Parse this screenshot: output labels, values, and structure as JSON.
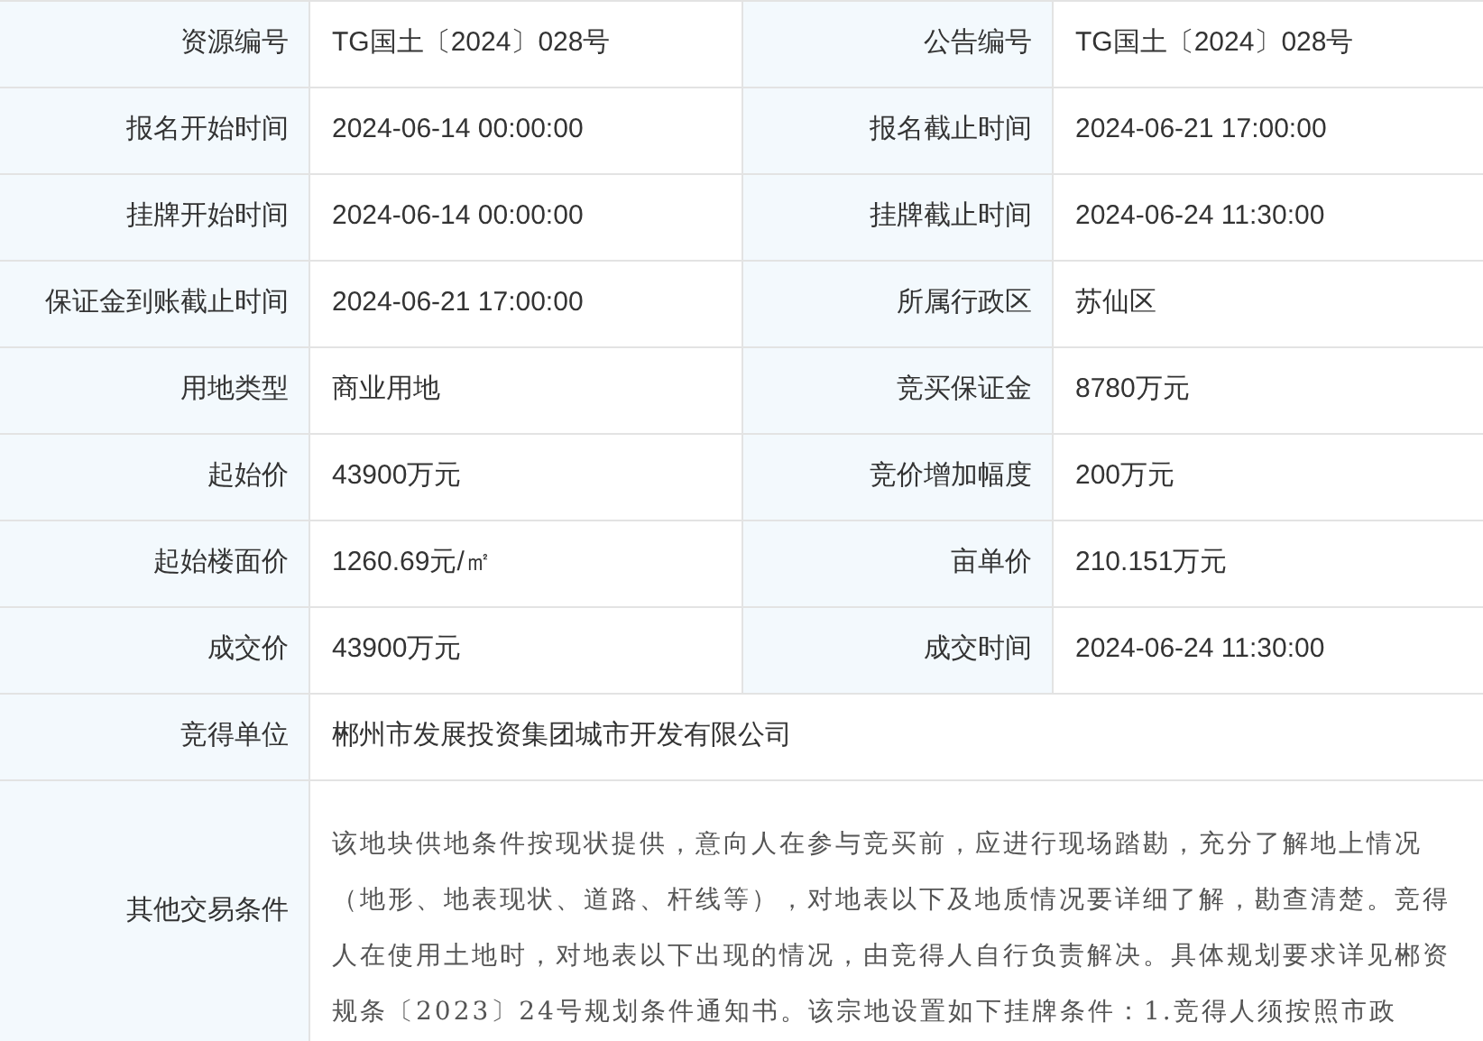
{
  "rows": [
    {
      "cells": [
        {
          "label": "资源编号",
          "value": "TG国土〔2024〕028号"
        },
        {
          "label": "公告编号",
          "value": "TG国土〔2024〕028号"
        }
      ]
    },
    {
      "cells": [
        {
          "label": "报名开始时间",
          "value": "2024-06-14 00:00:00"
        },
        {
          "label": "报名截止时间",
          "value": "2024-06-21 17:00:00"
        }
      ]
    },
    {
      "cells": [
        {
          "label": "挂牌开始时间",
          "value": "2024-06-14 00:00:00"
        },
        {
          "label": "挂牌截止时间",
          "value": "2024-06-24 11:30:00"
        }
      ]
    },
    {
      "cells": [
        {
          "label": "保证金到账截止时间",
          "value": "2024-06-21 17:00:00"
        },
        {
          "label": "所属行政区",
          "value": "苏仙区"
        }
      ]
    },
    {
      "cells": [
        {
          "label": "用地类型",
          "value": "商业用地"
        },
        {
          "label": "竞买保证金",
          "value": "8780万元"
        }
      ]
    },
    {
      "cells": [
        {
          "label": "起始价",
          "value": "43900万元"
        },
        {
          "label": "竞价增加幅度",
          "value": "200万元"
        }
      ]
    },
    {
      "cells": [
        {
          "label": "起始楼面价",
          "value": "1260.69元/㎡"
        },
        {
          "label": "亩单价",
          "value": "210.151万元"
        }
      ]
    },
    {
      "cells": [
        {
          "label": "成交价",
          "value": "43900万元"
        },
        {
          "label": "成交时间",
          "value": "2024-06-24 11:30:00"
        }
      ]
    },
    {
      "cells": [
        {
          "label": "竞得单位",
          "value": "郴州市发展投资集团城市开发有限公司"
        }
      ]
    },
    {
      "cells": [
        {
          "label": "其他交易条件",
          "value": "该地块供地条件按现状提供，意向人在参与竞买前，应进行现场踏勘，充分了解地上情况（地形、地表现状、道路、杆线等），对地表以下及地质情况要详细了解，勘查清楚。竞得人在使用土地时，对地表以下出现的情况，由竞得人自行负责解决。具体规划要求详见郴资规条〔2023〕24号规划条件通知书。该宗地设置如下挂牌条件：1.竞得人须按照市政",
          "kind": "paragraph"
        }
      ]
    }
  ]
}
